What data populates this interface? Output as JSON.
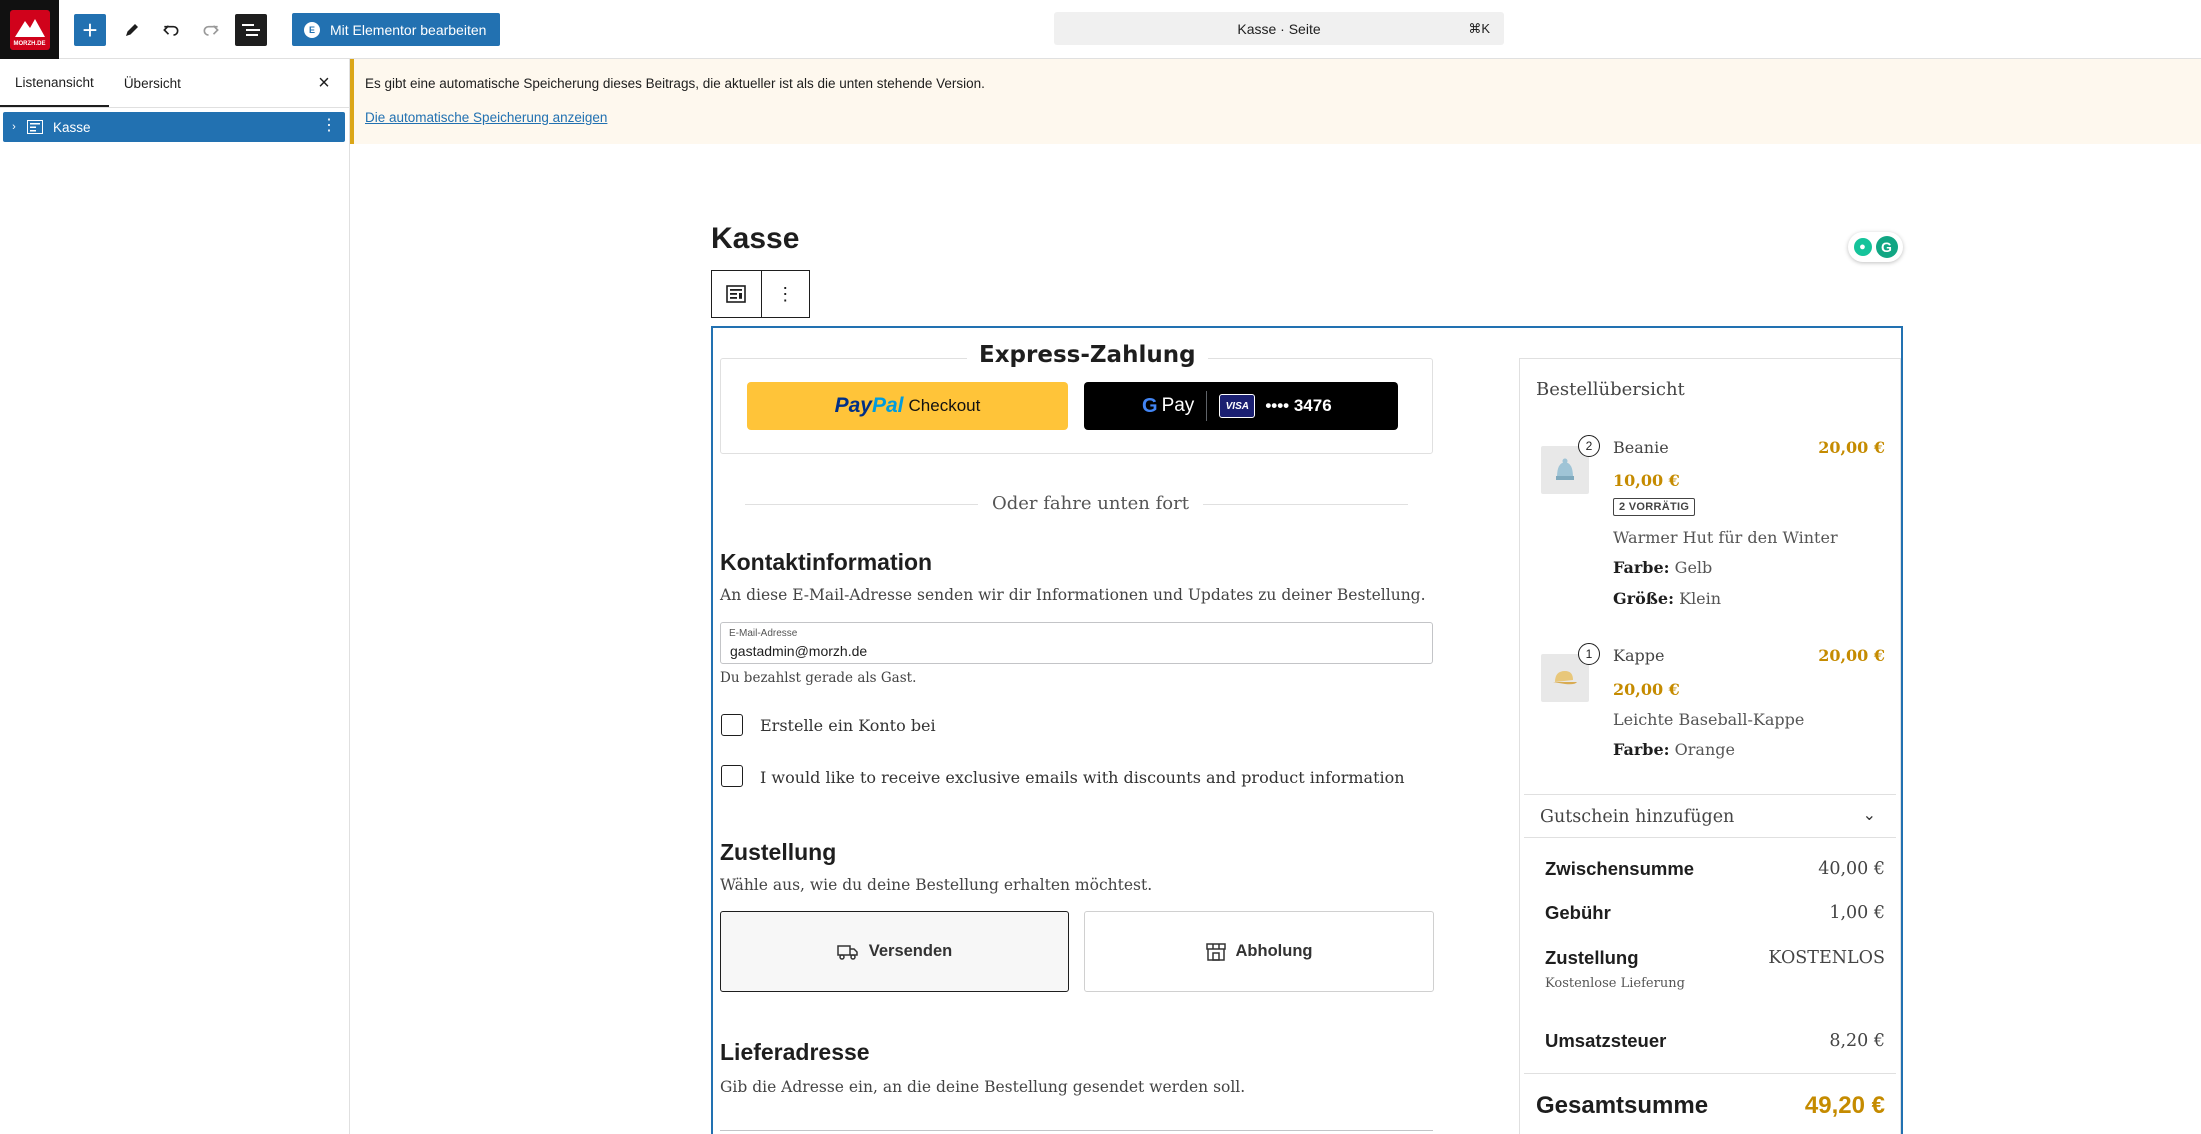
{
  "app": {
    "logo_text": "MORZH.DE",
    "elementor_label": "Mit Elementor bearbeiten",
    "command_bar_title": "Kasse · Seite",
    "command_shortcut": "⌘K"
  },
  "sidebar": {
    "tabs": [
      {
        "label": "Listenansicht",
        "active": true
      },
      {
        "label": "Übersicht",
        "active": false
      }
    ],
    "items": [
      {
        "label": "Kasse",
        "selected": true
      }
    ]
  },
  "notice": {
    "text": "Es gibt eine automatische Speicherung dieses Beitrags, die aktueller ist als die unten stehende Version.",
    "link": "Die automatische Speicherung anzeigen"
  },
  "page": {
    "title": "Kasse"
  },
  "checkout": {
    "express": {
      "title": "Express-Zahlung",
      "paypal": {
        "pay": "Pay",
        "pal": "Pal",
        "checkout": "Checkout"
      },
      "gpay": {
        "label": "Pay",
        "card_brand": "VISA",
        "card_digits": "•••• 3476"
      }
    },
    "or_text": "Oder fahre unten fort",
    "contact": {
      "heading": "Kontaktinformation",
      "description": "An diese E-Mail-Adresse senden wir dir Informationen und Updates zu deiner Bestellung.",
      "email_label": "E-Mail-Adresse",
      "email_value": "gastadmin@morzh.de",
      "guest_note": "Du bezahlst gerade als Gast.",
      "create_account": "Erstelle ein Konto bei",
      "newsletter": "I would like to receive exclusive emails with discounts and product information"
    },
    "delivery": {
      "heading": "Zustellung",
      "description": "Wähle aus, wie du deine Bestellung erhalten möchtest.",
      "options": [
        {
          "label": "Versenden",
          "selected": true
        },
        {
          "label": "Abholung",
          "selected": false
        }
      ]
    },
    "address": {
      "heading": "Lieferadresse",
      "description": "Gib die Adresse ein, an die deine Bestellung gesendet werden soll."
    }
  },
  "summary": {
    "title": "Bestellübersicht",
    "items": [
      {
        "qty": "2",
        "name": "Beanie",
        "total": "20,00 €",
        "unit_price": "10,00 €",
        "stock": "2 VORRÄTIG",
        "description": "Warmer Hut für den Winter",
        "meta": [
          {
            "key": "Farbe:",
            "value": "Gelb"
          },
          {
            "key": "Größe:",
            "value": "Klein"
          }
        ]
      },
      {
        "qty": "1",
        "name": "Kappe",
        "total": "20,00 €",
        "unit_price": "20,00 €",
        "description": "Leichte Baseball-Kappe",
        "meta": [
          {
            "key": "Farbe:",
            "value": "Orange"
          }
        ]
      }
    ],
    "coupon": "Gutschein hinzufügen",
    "totals": {
      "subtotal_label": "Zwischensumme",
      "subtotal_value": "40,00 €",
      "fee_label": "Gebühr",
      "fee_value": "1,00 €",
      "shipping_label": "Zustellung",
      "shipping_value": "KOSTENLOS",
      "shipping_sub": "Kostenlose Lieferung",
      "tax_label": "Umsatzsteuer",
      "tax_value": "8,20 €",
      "grand_label": "Gesamtsumme",
      "grand_value": "49,20 €"
    }
  },
  "colors": {
    "accent": "#2271b1",
    "price": "#c58b00",
    "notice_border": "#dba617",
    "paypal_yellow": "#ffc439"
  }
}
